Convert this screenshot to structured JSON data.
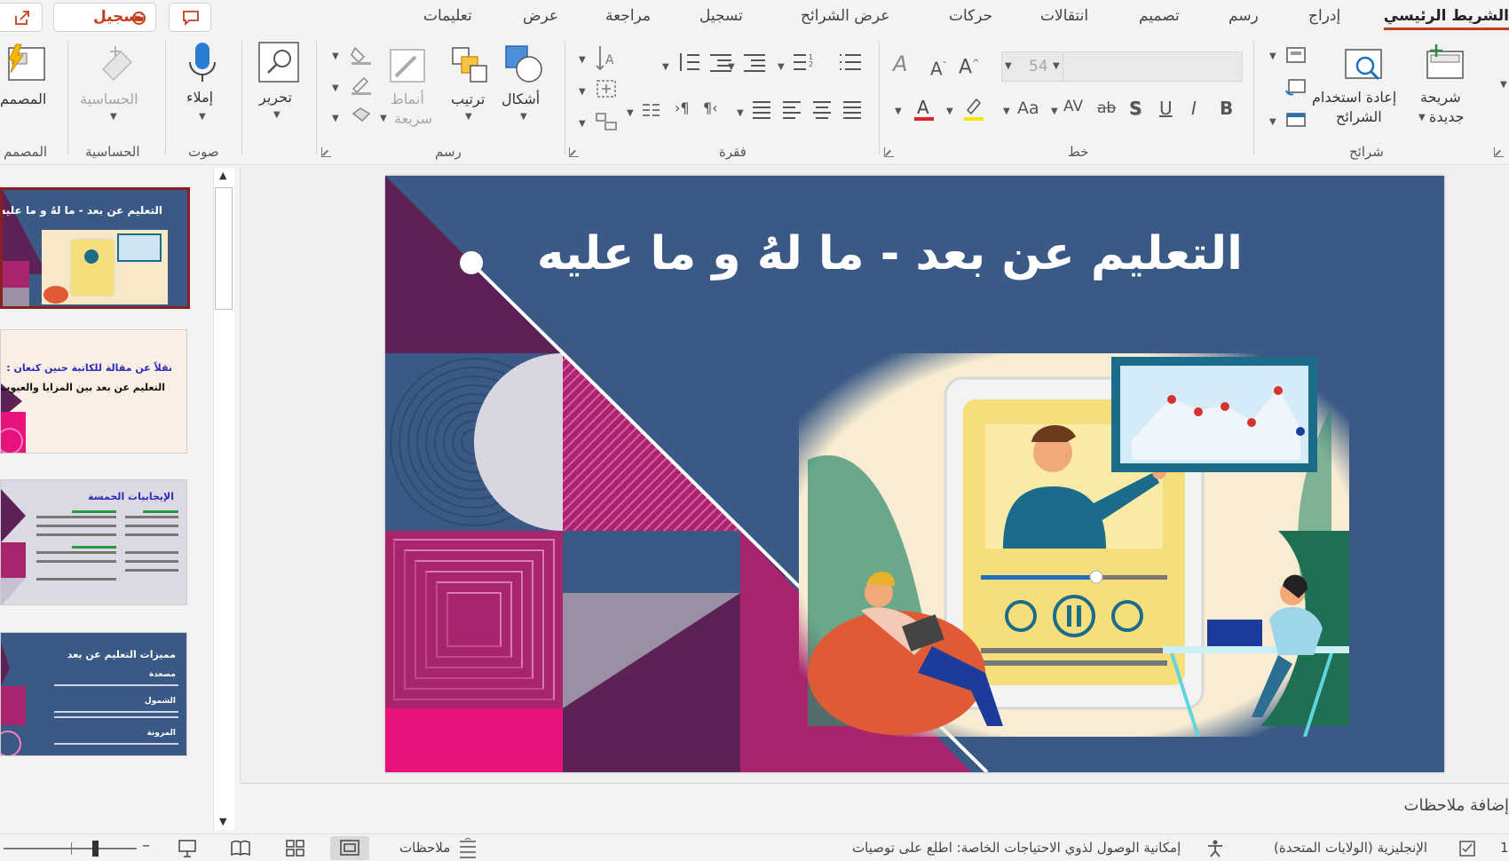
{
  "tabs": [
    {
      "label": "الشريط الرئيسي",
      "active": true
    },
    {
      "label": "إدراج"
    },
    {
      "label": "رسم"
    },
    {
      "label": "تصميم"
    },
    {
      "label": "انتقالات"
    },
    {
      "label": "حركات"
    },
    {
      "label": "عرض الشرائح"
    },
    {
      "label": "تسجيل"
    },
    {
      "label": "مراجعة"
    },
    {
      "label": "عرض"
    },
    {
      "label": "تعليمات"
    }
  ],
  "record_button": "تسجيل",
  "ribbon": {
    "slides": {
      "group": "شرائح",
      "new_slide_l1": "شريحة",
      "new_slide_l2": "جديدة",
      "reuse_l1": "إعادة استخدام",
      "reuse_l2": "الشرائح"
    },
    "font": {
      "group": "خط",
      "size_value": "54"
    },
    "paragraph": {
      "group": "فقرة"
    },
    "drawing": {
      "group": "رسم",
      "shapes": "أشكال",
      "arrange": "ترتيب",
      "quick_styles_l1": "أنماط",
      "quick_styles_l2": "سريعة"
    },
    "editing": {
      "label": "تحرير"
    },
    "voice": {
      "group": "صوت",
      "dictate": "إملاء"
    },
    "sensitivity": {
      "group": "الحساسية",
      "label": "الحساسية"
    },
    "designer": {
      "group": "المصمم",
      "label": "المصمم"
    }
  },
  "slide": {
    "title": "التعليم عن بعد  -  ما لهُ  و  ما عليه"
  },
  "thumbnails": [
    {
      "title": "التعليم عن بعد - ما لهُ و ما عليه"
    },
    {
      "line1": "نقلاً عن مقالة للكاتبة حنين كنعان :",
      "line2": "التعليم عن بعد بين المزايا والعيوب ."
    },
    {
      "title": "الإيجابيات الخمسة"
    },
    {
      "title": "مميزات التعليم عن بعد",
      "h1": "مصعدة",
      "h2": "الشمول",
      "h3": "المرونة"
    }
  ],
  "notes_label": "إضافة ملاحظات",
  "status": {
    "language": "الإنجليزية (الولايات المتحدة)",
    "accessibility": "إمكانية الوصول لذوي الاحتياجات الخاصة: اطلع على توصيات",
    "notes_button": "ملاحظات"
  },
  "colors": {
    "accent": "#c43e1c",
    "slide_bg": "#3a5a85",
    "magenta": "#a8256e",
    "plum": "#5c2155",
    "pink": "#e8127c"
  }
}
